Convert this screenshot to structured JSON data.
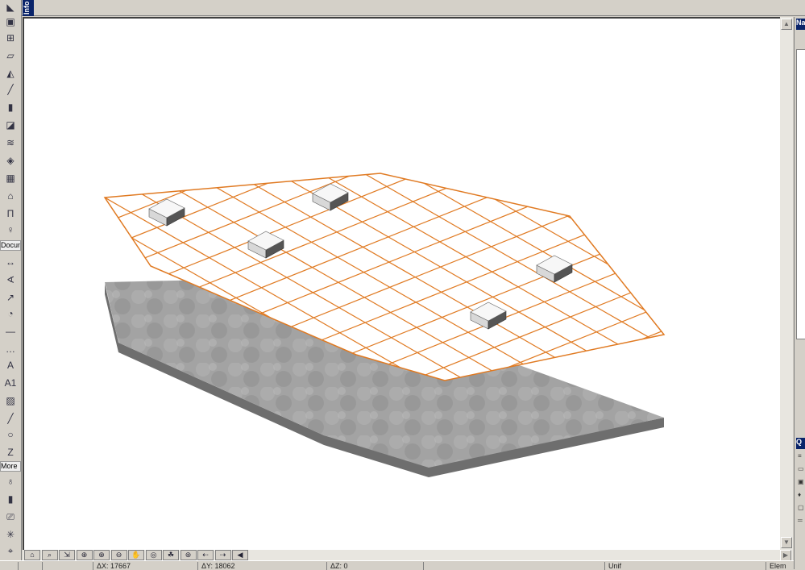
{
  "window": {
    "info_tab": "Info"
  },
  "toolbox": {
    "docum_label": "Docum",
    "more_label": "More",
    "tools": [
      "arrow",
      "marquee",
      "wall",
      "column",
      "beam",
      "slab",
      "roof",
      "mesh",
      "stair",
      "window",
      "door",
      "object",
      "lamp",
      "zone"
    ]
  },
  "nav_buttons": [
    "explore",
    "zoom-window",
    "fit",
    "zoom-dialog",
    "zoom-in",
    "zoom-out",
    "pan",
    "orbit",
    "walk",
    "fit-in-window",
    "prev-zoom",
    "next-zoom",
    "scroll-left"
  ],
  "status": {
    "dx": "ΔX: 17667",
    "dy": "ΔY: 18062",
    "dz": "ΔZ: 0",
    "unit": "Unif",
    "right": "Elem"
  },
  "panels": {
    "navigator": "Na",
    "quick": "Q"
  },
  "colors": {
    "mesh": "#e07a22",
    "slab": "#9a9a9a"
  }
}
